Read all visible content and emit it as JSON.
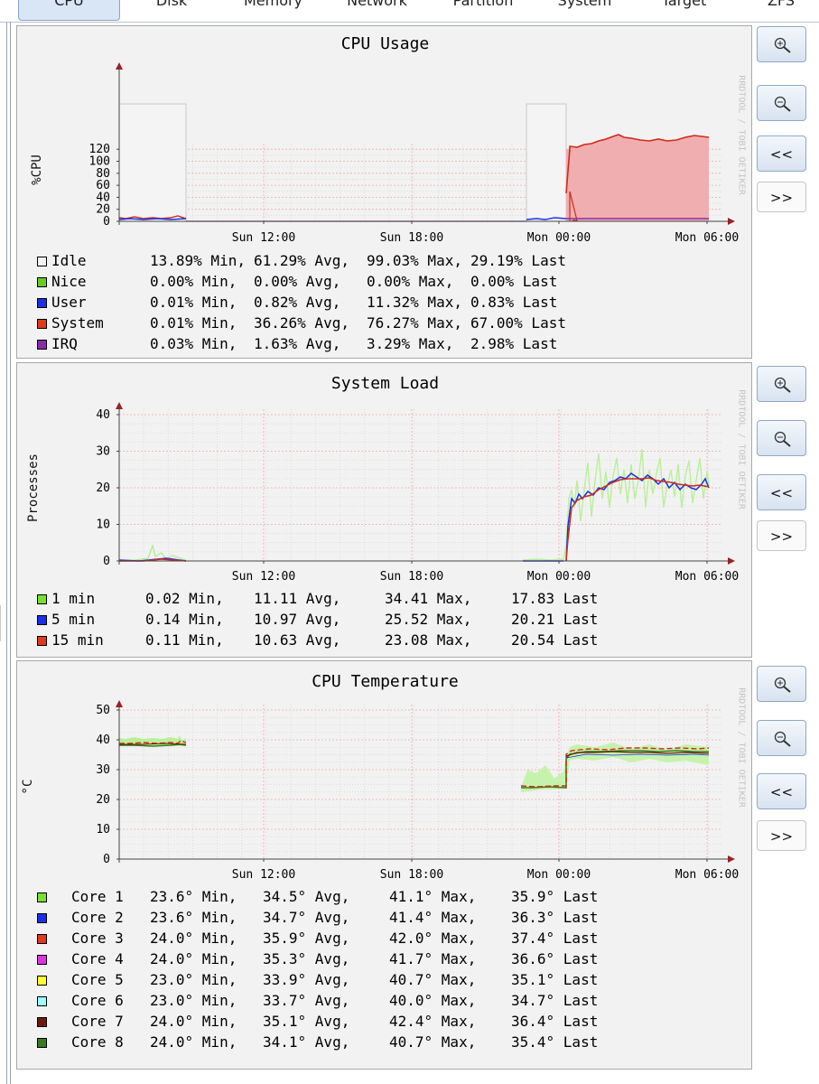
{
  "tabs": [
    {
      "label": "CPU",
      "active": true
    },
    {
      "label": "Disk",
      "active": false
    },
    {
      "label": "Memory",
      "active": false
    },
    {
      "label": "Network",
      "active": false
    },
    {
      "label": "Partition",
      "active": false
    },
    {
      "label": "System",
      "active": false
    },
    {
      "label": "Target",
      "active": false
    },
    {
      "label": "ZFS",
      "active": false
    }
  ],
  "buttons": {
    "zoom_in": "zoom-in-icon",
    "zoom_out": "zoom-out-icon",
    "prev": "<<",
    "next": ">>"
  },
  "watermark": "RRDTOOL / TOBI OETIKER",
  "x_labels": [
    "Sun 12:00",
    "Sun 18:00",
    "Mon 00:00",
    "Mon 06:00"
  ],
  "graphs": [
    {
      "id": "cpu",
      "title": "CPU Usage",
      "ylabel": "%CPU",
      "yticks": [
        "120",
        "100",
        "80",
        "60",
        "40",
        "20",
        "0"
      ],
      "legend": [
        {
          "name": "Idle",
          "color": "#f2f2f2",
          "min": "13.89% Min,",
          "avg": "61.29% Avg,",
          "max": "99.03% Max,",
          "last": "29.19% Last"
        },
        {
          "name": "Nice",
          "color": "#66cc22",
          "min": "0.00% Min,",
          "avg": "0.00% Avg,",
          "max": "0.00% Max,",
          "last": "0.00% Last"
        },
        {
          "name": "User",
          "color": "#1b30e6",
          "min": "0.01% Min,",
          "avg": "0.82% Avg,",
          "max": "11.32% Max,",
          "last": "0.83% Last"
        },
        {
          "name": "System",
          "color": "#e03a1c",
          "min": "0.01% Min,",
          "avg": "36.26% Avg,",
          "max": "76.27% Max,",
          "last": "67.00% Last"
        },
        {
          "name": "IRQ",
          "color": "#8a2aa8",
          "min": "0.03% Min,",
          "avg": "1.63% Avg,",
          "max": "3.29% Max,",
          "last": "2.98% Last"
        }
      ]
    },
    {
      "id": "load",
      "title": "System Load",
      "ylabel": "Processes",
      "yticks": [
        "40",
        "30",
        "20",
        "10",
        "0"
      ],
      "legend": [
        {
          "name": "1 min",
          "color": "#77e033",
          "min": "0.02 Min,",
          "avg": "11.11 Avg,",
          "max": "34.41 Max,",
          "last": "17.83 Last"
        },
        {
          "name": "5 min",
          "color": "#1b30e6",
          "min": "0.14 Min,",
          "avg": "10.97 Avg,",
          "max": "25.52 Max,",
          "last": "20.21 Last"
        },
        {
          "name": "15 min",
          "color": "#e03a1c",
          "min": "0.11 Min,",
          "avg": "10.63 Avg,",
          "max": "23.08 Max,",
          "last": "20.54 Last"
        }
      ]
    },
    {
      "id": "temp",
      "title": "CPU Temperature",
      "ylabel": "°C",
      "yticks": [
        "50",
        "40",
        "30",
        "20",
        "10",
        "0"
      ],
      "legend": [
        {
          "name": "Core 1",
          "color": "#77e033",
          "min": "23.6° Min,",
          "avg": "34.5° Avg,",
          "max": "41.1° Max,",
          "last": "35.9° Last"
        },
        {
          "name": "Core 2",
          "color": "#1b30e6",
          "min": "23.6° Min,",
          "avg": "34.7° Avg,",
          "max": "41.4° Max,",
          "last": "36.3° Last"
        },
        {
          "name": "Core 3",
          "color": "#e03a1c",
          "min": "24.0° Min,",
          "avg": "35.9° Avg,",
          "max": "42.0° Max,",
          "last": "37.4° Last"
        },
        {
          "name": "Core 4",
          "color": "#e033e0",
          "min": "24.0° Min,",
          "avg": "35.3° Avg,",
          "max": "41.7° Max,",
          "last": "36.6° Last"
        },
        {
          "name": "Core 5",
          "color": "#ffff33",
          "min": "23.0° Min,",
          "avg": "33.9° Avg,",
          "max": "40.7° Max,",
          "last": "35.1° Last"
        },
        {
          "name": "Core 6",
          "color": "#99ffff",
          "min": "23.0° Min,",
          "avg": "33.7° Avg,",
          "max": "40.0° Max,",
          "last": "34.7° Last"
        },
        {
          "name": "Core 7",
          "color": "#6b1a0a",
          "min": "24.0° Min,",
          "avg": "35.1° Avg,",
          "max": "42.4° Max,",
          "last": "36.4° Last"
        },
        {
          "name": "Core 8",
          "color": "#3a7a22",
          "min": "24.0° Min,",
          "avg": "34.1° Avg,",
          "max": "40.7° Max,",
          "last": "35.4° Last"
        }
      ]
    }
  ],
  "chart_data": [
    {
      "type": "area",
      "title": "CPU Usage",
      "ylabel": "%CPU",
      "xlabel": "",
      "ylim": [
        0,
        120
      ],
      "x_ticks": [
        "Sun 12:00",
        "Sun 18:00",
        "Mon 00:00",
        "Mon 06:00"
      ],
      "grid": true,
      "series": [
        {
          "name": "Idle",
          "stat_min": 13.89,
          "stat_avg": 61.29,
          "stat_max": 99.03,
          "stat_last": 29.19
        },
        {
          "name": "Nice",
          "stat_min": 0.0,
          "stat_avg": 0.0,
          "stat_max": 0.0,
          "stat_last": 0.0
        },
        {
          "name": "User",
          "stat_min": 0.01,
          "stat_avg": 0.82,
          "stat_max": 11.32,
          "stat_last": 0.83
        },
        {
          "name": "System",
          "stat_min": 0.01,
          "stat_avg": 36.26,
          "stat_max": 76.27,
          "stat_last": 67.0
        },
        {
          "name": "IRQ",
          "stat_min": 0.03,
          "stat_avg": 1.63,
          "stat_max": 3.29,
          "stat_last": 2.98
        }
      ]
    },
    {
      "type": "line",
      "title": "System Load",
      "ylabel": "Processes",
      "xlabel": "",
      "ylim": [
        0,
        40
      ],
      "x_ticks": [
        "Sun 12:00",
        "Sun 18:00",
        "Mon 00:00",
        "Mon 06:00"
      ],
      "grid": true,
      "series": [
        {
          "name": "1 min",
          "stat_min": 0.02,
          "stat_avg": 11.11,
          "stat_max": 34.41,
          "stat_last": 17.83
        },
        {
          "name": "5 min",
          "stat_min": 0.14,
          "stat_avg": 10.97,
          "stat_max": 25.52,
          "stat_last": 20.21
        },
        {
          "name": "15 min",
          "stat_min": 0.11,
          "stat_avg": 10.63,
          "stat_max": 23.08,
          "stat_last": 20.54
        }
      ]
    },
    {
      "type": "line",
      "title": "CPU Temperature",
      "ylabel": "°C",
      "xlabel": "",
      "ylim": [
        0,
        50
      ],
      "x_ticks": [
        "Sun 12:00",
        "Sun 18:00",
        "Mon 00:00",
        "Mon 06:00"
      ],
      "grid": true,
      "series": [
        {
          "name": "Core 1",
          "stat_min": 23.6,
          "stat_avg": 34.5,
          "stat_max": 41.1,
          "stat_last": 35.9
        },
        {
          "name": "Core 2",
          "stat_min": 23.6,
          "stat_avg": 34.7,
          "stat_max": 41.4,
          "stat_last": 36.3
        },
        {
          "name": "Core 3",
          "stat_min": 24.0,
          "stat_avg": 35.9,
          "stat_max": 42.0,
          "stat_last": 37.4
        },
        {
          "name": "Core 4",
          "stat_min": 24.0,
          "stat_avg": 35.3,
          "stat_max": 41.7,
          "stat_last": 36.6
        },
        {
          "name": "Core 5",
          "stat_min": 23.0,
          "stat_avg": 33.9,
          "stat_max": 40.7,
          "stat_last": 35.1
        },
        {
          "name": "Core 6",
          "stat_min": 23.0,
          "stat_avg": 33.7,
          "stat_max": 40.0,
          "stat_last": 34.7
        },
        {
          "name": "Core 7",
          "stat_min": 24.0,
          "stat_avg": 35.1,
          "stat_max": 42.4,
          "stat_last": 36.4
        },
        {
          "name": "Core 8",
          "stat_min": 24.0,
          "stat_avg": 34.1,
          "stat_max": 40.7,
          "stat_last": 35.4
        }
      ]
    }
  ]
}
